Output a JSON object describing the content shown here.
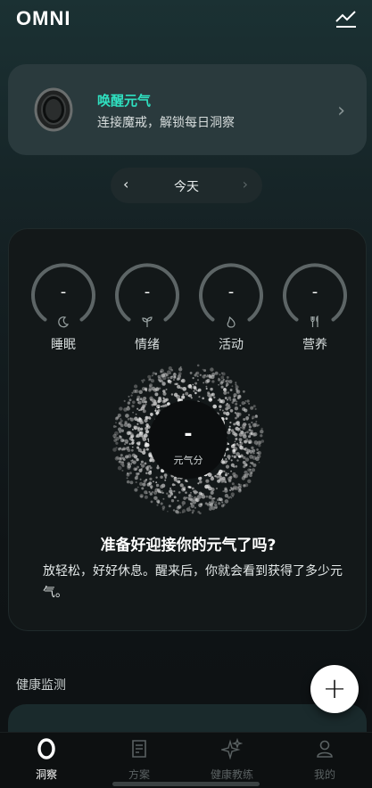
{
  "header": {
    "logo": "OMNI",
    "trend_icon": "trend-chart-icon"
  },
  "connect": {
    "title": "唤醒元气",
    "subtitle": "连接魔戒，解锁每日洞察",
    "icon": "smart-ring-image",
    "accent": "#2fe0c0"
  },
  "date_nav": {
    "label": "今天",
    "prev": "‹",
    "next": "›"
  },
  "metrics": [
    {
      "label": "睡眠",
      "value": "-",
      "icon": "moon-icon"
    },
    {
      "label": "情绪",
      "value": "-",
      "icon": "sprout-icon"
    },
    {
      "label": "活动",
      "value": "-",
      "icon": "flame-icon"
    },
    {
      "label": "营养",
      "value": "-",
      "icon": "utensils-icon"
    }
  ],
  "score": {
    "value": "-",
    "label": "元气分",
    "headline": "准备好迎接你的元气了吗?",
    "description": "放轻松，好好休息。醒来后，你就会看到获得了多少元气。"
  },
  "health": {
    "section_title": "健康监测",
    "fab": "+"
  },
  "tabs": [
    {
      "label": "洞察",
      "icon": "insight-ring-icon",
      "active": true
    },
    {
      "label": "方案",
      "icon": "document-icon",
      "active": false
    },
    {
      "label": "健康教练",
      "icon": "sparkle-icon",
      "active": false
    },
    {
      "label": "我的",
      "icon": "person-icon",
      "active": false
    }
  ]
}
